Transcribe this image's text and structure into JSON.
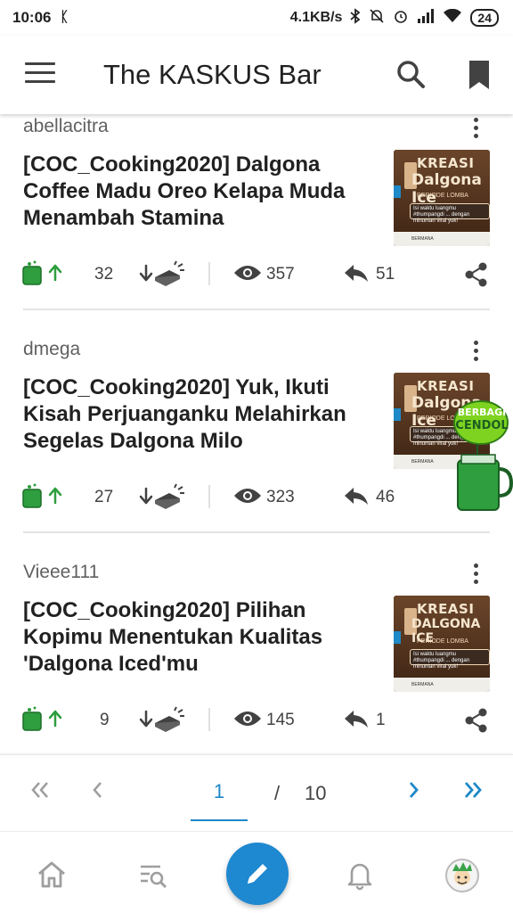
{
  "status": {
    "time": "10:06",
    "network_speed": "4.1KB/s",
    "battery": "24"
  },
  "app_bar": {
    "title": "The KASKUS Bar"
  },
  "threads": [
    {
      "username": "abellacitra",
      "title": "[COC_Cooking2020] Dalgona Coffee Madu Oreo Kelapa Muda Menambah Stamina",
      "cendol": "32",
      "views": "357",
      "replies": "51",
      "thumb": {
        "line1": "KREASI",
        "line2": "Dalgona Ice",
        "line3": "PERIODE LOMBA",
        "line4": "Isi waktu luangmu #thumpangdi ... dengan minuman viral yuk!",
        "line5": "BERMANA"
      }
    },
    {
      "username": "dmega",
      "title": "[COC_Cooking2020] Yuk, Ikuti Kisah Perjuanganku Melahirkan Segelas Dalgona Milo",
      "cendol": "27",
      "views": "323",
      "replies": "46",
      "thumb": {
        "line1": "KREASI",
        "line2": "Dalgona Ice",
        "line3": "PERIODE LOMBA",
        "line4": "Isi waktu luangmu #thumpangdi ... dengan minuman viral yuk!",
        "line5": "BERMANA"
      }
    },
    {
      "username": "Vieee111",
      "title": "[COC_Cooking2020] Pilihan Kopimu Menentukan Kualitas 'Dalgona Iced'mu",
      "cendol": "9",
      "views": "145",
      "replies": "1",
      "thumb": {
        "line1": "KREASI",
        "line2": "DALGONA ICE",
        "line3": "PERIODE LOMBA",
        "line4": "Isi waktu luangmu #thumpangdi ... dengan minuman viral yuk!",
        "line5": "BERMANA"
      }
    }
  ],
  "cendol_widget": {
    "line1": "BERBAGI",
    "line2": "CENDOL"
  },
  "pagination": {
    "current": "1",
    "separator": "/",
    "total": "10"
  },
  "colors": {
    "accent": "#1e88c8",
    "cendol_green": "#2e9e3e",
    "text_primary": "#212121",
    "text_secondary": "#616161"
  },
  "icons": {
    "menu": "hamburger-icon",
    "search": "search-icon",
    "bookmark": "bookmark-icon",
    "more": "more-vert-icon",
    "cendol": "cendol-cup-icon",
    "upvote": "arrow-up-icon",
    "downvote": "arrow-down-icon",
    "bata": "brick-icon",
    "views": "eye-icon",
    "reply": "reply-icon",
    "share": "share-icon",
    "home": "home-icon",
    "browse": "browse-search-icon",
    "create": "pencil-icon",
    "notifications": "bell-icon"
  }
}
